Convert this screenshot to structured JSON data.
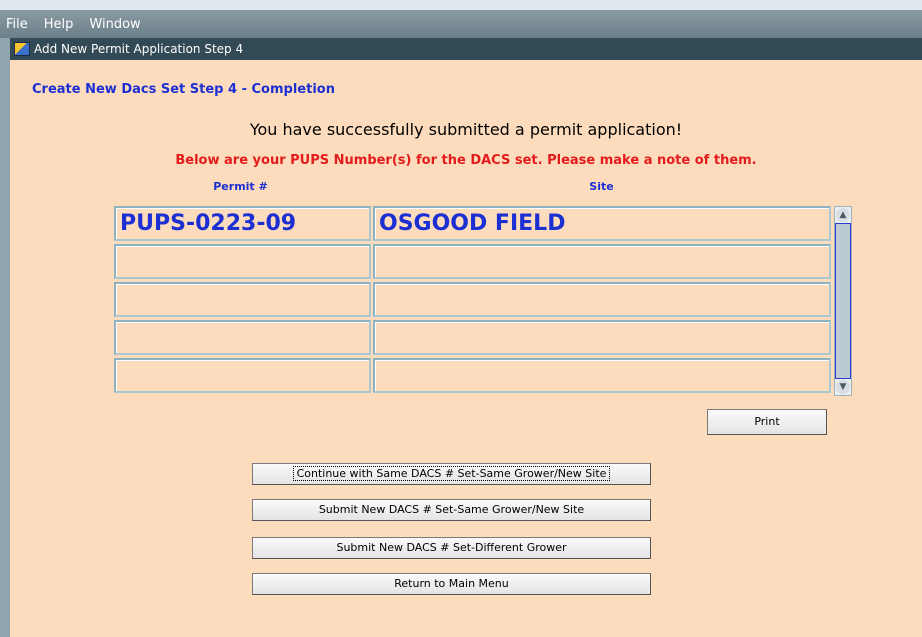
{
  "menu": {
    "file": "File",
    "help": "Help",
    "window": "Window"
  },
  "window": {
    "title": "Add New Permit Application Step 4"
  },
  "content": {
    "heading": "Create New Dacs Set Step 4 - Completion",
    "success_message": "You have successfully submitted a permit application!",
    "note_message": "Below are your PUPS Number(s) for the DACS set. Please make a note of them.",
    "columns": {
      "permit": "Permit #",
      "site": "Site"
    },
    "rows": [
      {
        "permit": "PUPS-0223-09",
        "site": "OSGOOD FIELD"
      },
      {
        "permit": "",
        "site": ""
      },
      {
        "permit": "",
        "site": ""
      },
      {
        "permit": "",
        "site": ""
      },
      {
        "permit": "",
        "site": ""
      }
    ]
  },
  "buttons": {
    "print": "Print",
    "continue_same": "Continue with Same DACS # Set-Same Grower/New Site",
    "submit_new_site": "Submit New DACS # Set-Same Grower/New Site",
    "submit_diff_grower": "Submit New DACS # Set-Different Grower",
    "return_main": "Return to Main Menu"
  },
  "icons": {
    "app": "app-icon",
    "scroll_up": "scroll-up-arrow-icon",
    "scroll_down": "scroll-down-arrow-icon"
  },
  "colors": {
    "panel_bg": "#fcdcbd",
    "heading_blue": "#1c2fd3",
    "note_red": "#e31b1b",
    "titlebar": "#324a55"
  }
}
